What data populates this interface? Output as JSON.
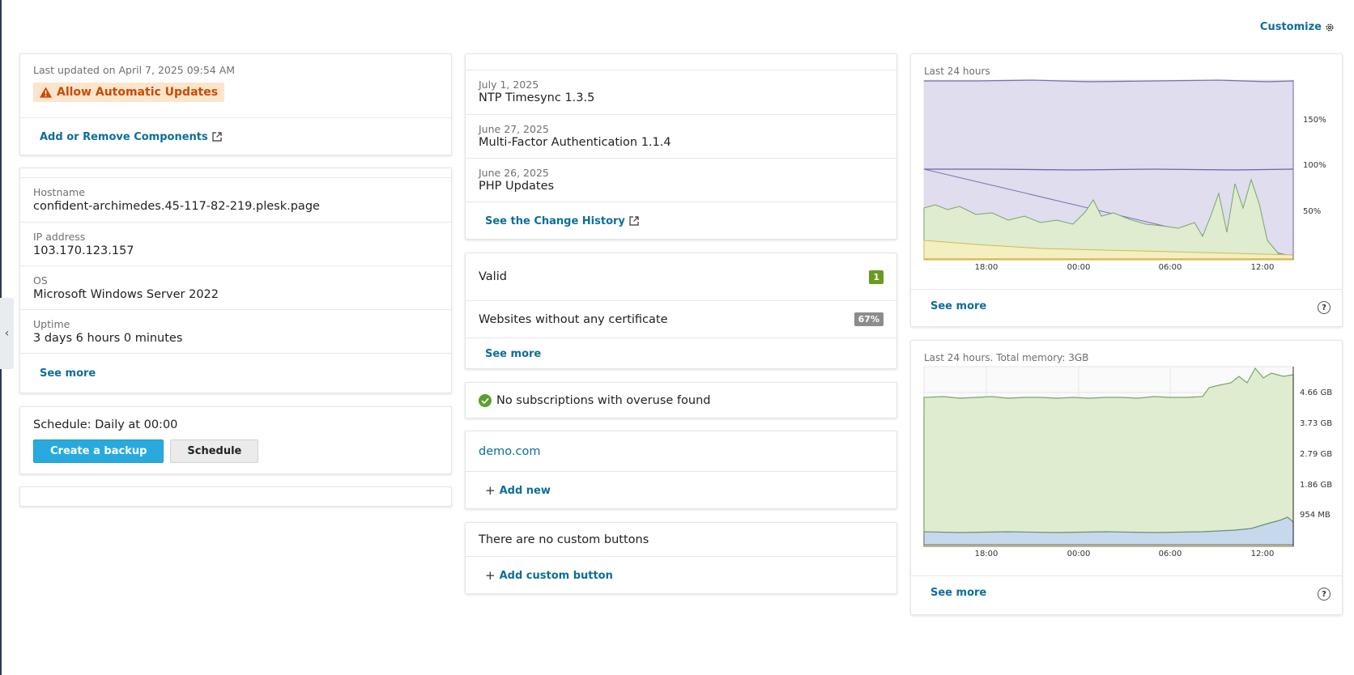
{
  "header": {
    "customize_label": "Customize"
  },
  "updates": {
    "last_updated": "Last updated on April 7, 2025 09:54 AM",
    "warning_label": "Allow Automatic Updates",
    "components_link": "Add or Remove Components"
  },
  "server": {
    "hostname_label": "Hostname",
    "hostname": "confident-archimedes.45-117-82-219.plesk.page",
    "ip_label": "IP address",
    "ip": "103.170.123.157",
    "os_label": "OS",
    "os": "Microsoft Windows Server 2022",
    "uptime_label": "Uptime",
    "uptime": "3 days 6 hours 0 minutes",
    "see_more": "See more"
  },
  "backup": {
    "schedule_text": "Schedule: Daily at 00:00",
    "create_button": "Create a backup",
    "schedule_button": "Schedule"
  },
  "changes": {
    "items": [
      {
        "date": "July 1, 2025",
        "title": "NTP Timesync 1.3.5"
      },
      {
        "date": "June 27, 2025",
        "title": "Multi-Factor Authentication 1.1.4"
      },
      {
        "date": "June 26, 2025",
        "title": "PHP Updates"
      }
    ],
    "history_link": "See the Change History"
  },
  "certificates": {
    "rows": [
      {
        "label": "Valid",
        "badge": "1",
        "badge_color": "#6a9a1f"
      },
      {
        "label": "Websites without any certificate",
        "badge": "67%",
        "badge_color": "#8c8c8c"
      }
    ],
    "see_more": "See more"
  },
  "overuse": {
    "text": "No subscriptions with overuse found",
    "icon": "check-circle-icon",
    "icon_color": "#5aa02c"
  },
  "domains": {
    "domain": "demo.com",
    "add_new": "Add new"
  },
  "custom_buttons": {
    "empty_text": "There are no custom buttons",
    "add_link": "Add custom button"
  },
  "cpu_chart": {
    "caption": "Last 24 hours",
    "see_more": "See more",
    "chart_data": {
      "type": "area",
      "x_ticks": [
        "18:00",
        "00:00",
        "06:00",
        "12:00"
      ],
      "y_ticks": [
        "50%",
        "100%",
        "150%"
      ],
      "ylim": [
        0,
        200
      ]
    }
  },
  "memory_chart": {
    "caption": "Last 24 hours. Total memory: 3GB",
    "see_more": "See more",
    "chart_data": {
      "type": "area",
      "x_ticks": [
        "18:00",
        "00:00",
        "06:00",
        "12:00"
      ],
      "y_ticks": [
        "954 MB",
        "1.86 GB",
        "2.79 GB",
        "3.73 GB",
        "4.66 GB"
      ],
      "ylim": [
        0,
        5.2
      ]
    }
  }
}
